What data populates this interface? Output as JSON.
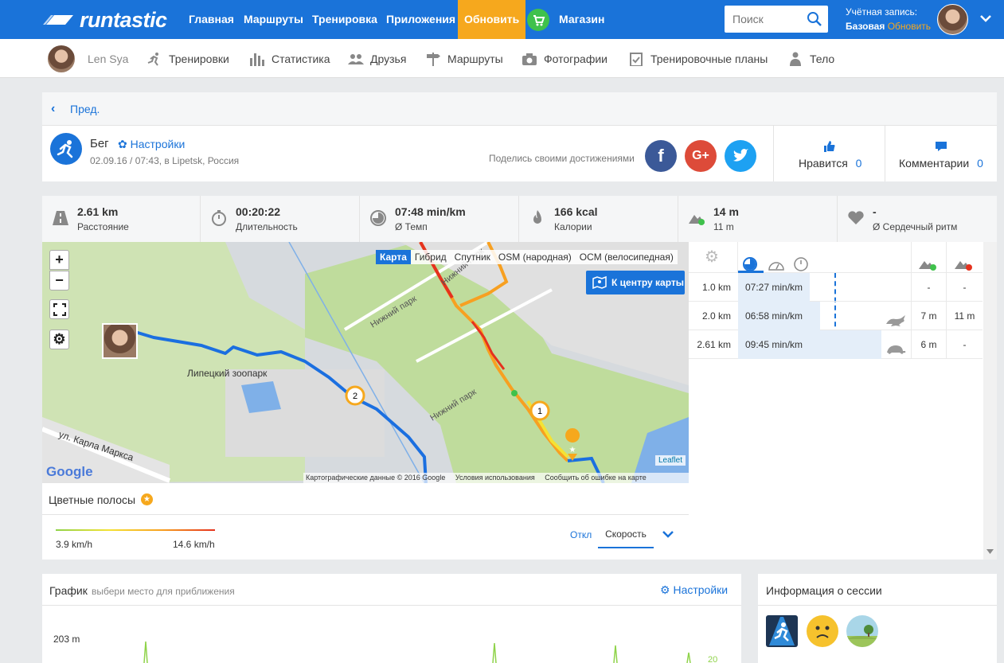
{
  "brand": {
    "name": "runtastic"
  },
  "topnav": {
    "items": [
      "Главная",
      "Маршруты",
      "Тренировка",
      "Приложения"
    ],
    "upgrade": "Обновить",
    "shop": "Магазин",
    "search_placeholder": "Поиск",
    "account_label": "Учётная запись:",
    "account_type": "Базовая",
    "account_upgrade": "Обновить"
  },
  "subnav": {
    "user": "Len Sya",
    "items": [
      "Тренировки",
      "Статистика",
      "Друзья",
      "Маршруты",
      "Фотографии",
      "Тренировочные планы",
      "Тело"
    ]
  },
  "back": "Пред.",
  "activity": {
    "sport": "Бег",
    "settings": "Настройки",
    "datetime": "02.09.16 / 07:43, в Lipetsk, Россия",
    "share_text": "Поделись своими достижениями",
    "likes_label": "Нравится",
    "likes_count": "0",
    "comments_label": "Комментарии",
    "comments_count": "0"
  },
  "stats": [
    {
      "value": "2.61 km",
      "label": "Расстояние",
      "icon": "road-icon"
    },
    {
      "value": "00:20:22",
      "label": "Длительность",
      "icon": "stopwatch-icon"
    },
    {
      "value": "07:48 min/km",
      "label": "Ø Темп",
      "icon": "pace-icon"
    },
    {
      "value": "166 kcal",
      "label": "Калории",
      "icon": "flame-icon"
    },
    {
      "value": "14 m",
      "label": "11 m",
      "icon": "elevation-icon"
    },
    {
      "value": "-",
      "label": "Ø Сердечный ритм",
      "icon": "heart-icon"
    }
  ],
  "map": {
    "types": [
      "Карта",
      "Гибрид",
      "Спутник",
      "OSM (народная)",
      "OCM (велосипедная)"
    ],
    "active_type": "Карта",
    "center_button": "К центру карты",
    "labels": {
      "zoo": "Липецкий зоопарк",
      "park1": "Нижний парк",
      "park2": "Нижний парк",
      "park3": "Нижний парк",
      "street": "ул. Карла Маркса"
    },
    "markers": [
      "1",
      "2"
    ],
    "attribution": "Картографические данные © 2016 Google",
    "terms": "Условия использования",
    "report": "Сообщить об ошибке на карте",
    "leaflet": "Leaflet",
    "google": "Google"
  },
  "bands": {
    "title": "Цветные полосы",
    "min": "3.9 km/h",
    "max": "14.6 km/h",
    "off": "Откл",
    "mode": "Скорость"
  },
  "splits": [
    {
      "dist": "1.0 km",
      "pace": "07:27 min/km",
      "pace_fraction": 0.5,
      "icon": "",
      "up": "-",
      "down": "-"
    },
    {
      "dist": "2.0 km",
      "pace": "06:58 min/km",
      "pace_fraction": 0.57,
      "icon": "rabbit-icon",
      "up": "7 m",
      "down": "11 m"
    },
    {
      "dist": "2.61 km",
      "pace": "09:45 min/km",
      "pace_fraction": 1.0,
      "icon": "turtle-icon",
      "up": "6 m",
      "down": "-"
    }
  ],
  "graph": {
    "title": "График",
    "hint": "выбери место для приближения",
    "settings": "Настройки",
    "y_label": "203 m",
    "right_label": "20"
  },
  "session": {
    "title": "Информация о сессии"
  },
  "colors": {
    "brand": "#1a73d9",
    "upgrade": "#f6a81d",
    "route_blue": "#1b6fe0"
  }
}
